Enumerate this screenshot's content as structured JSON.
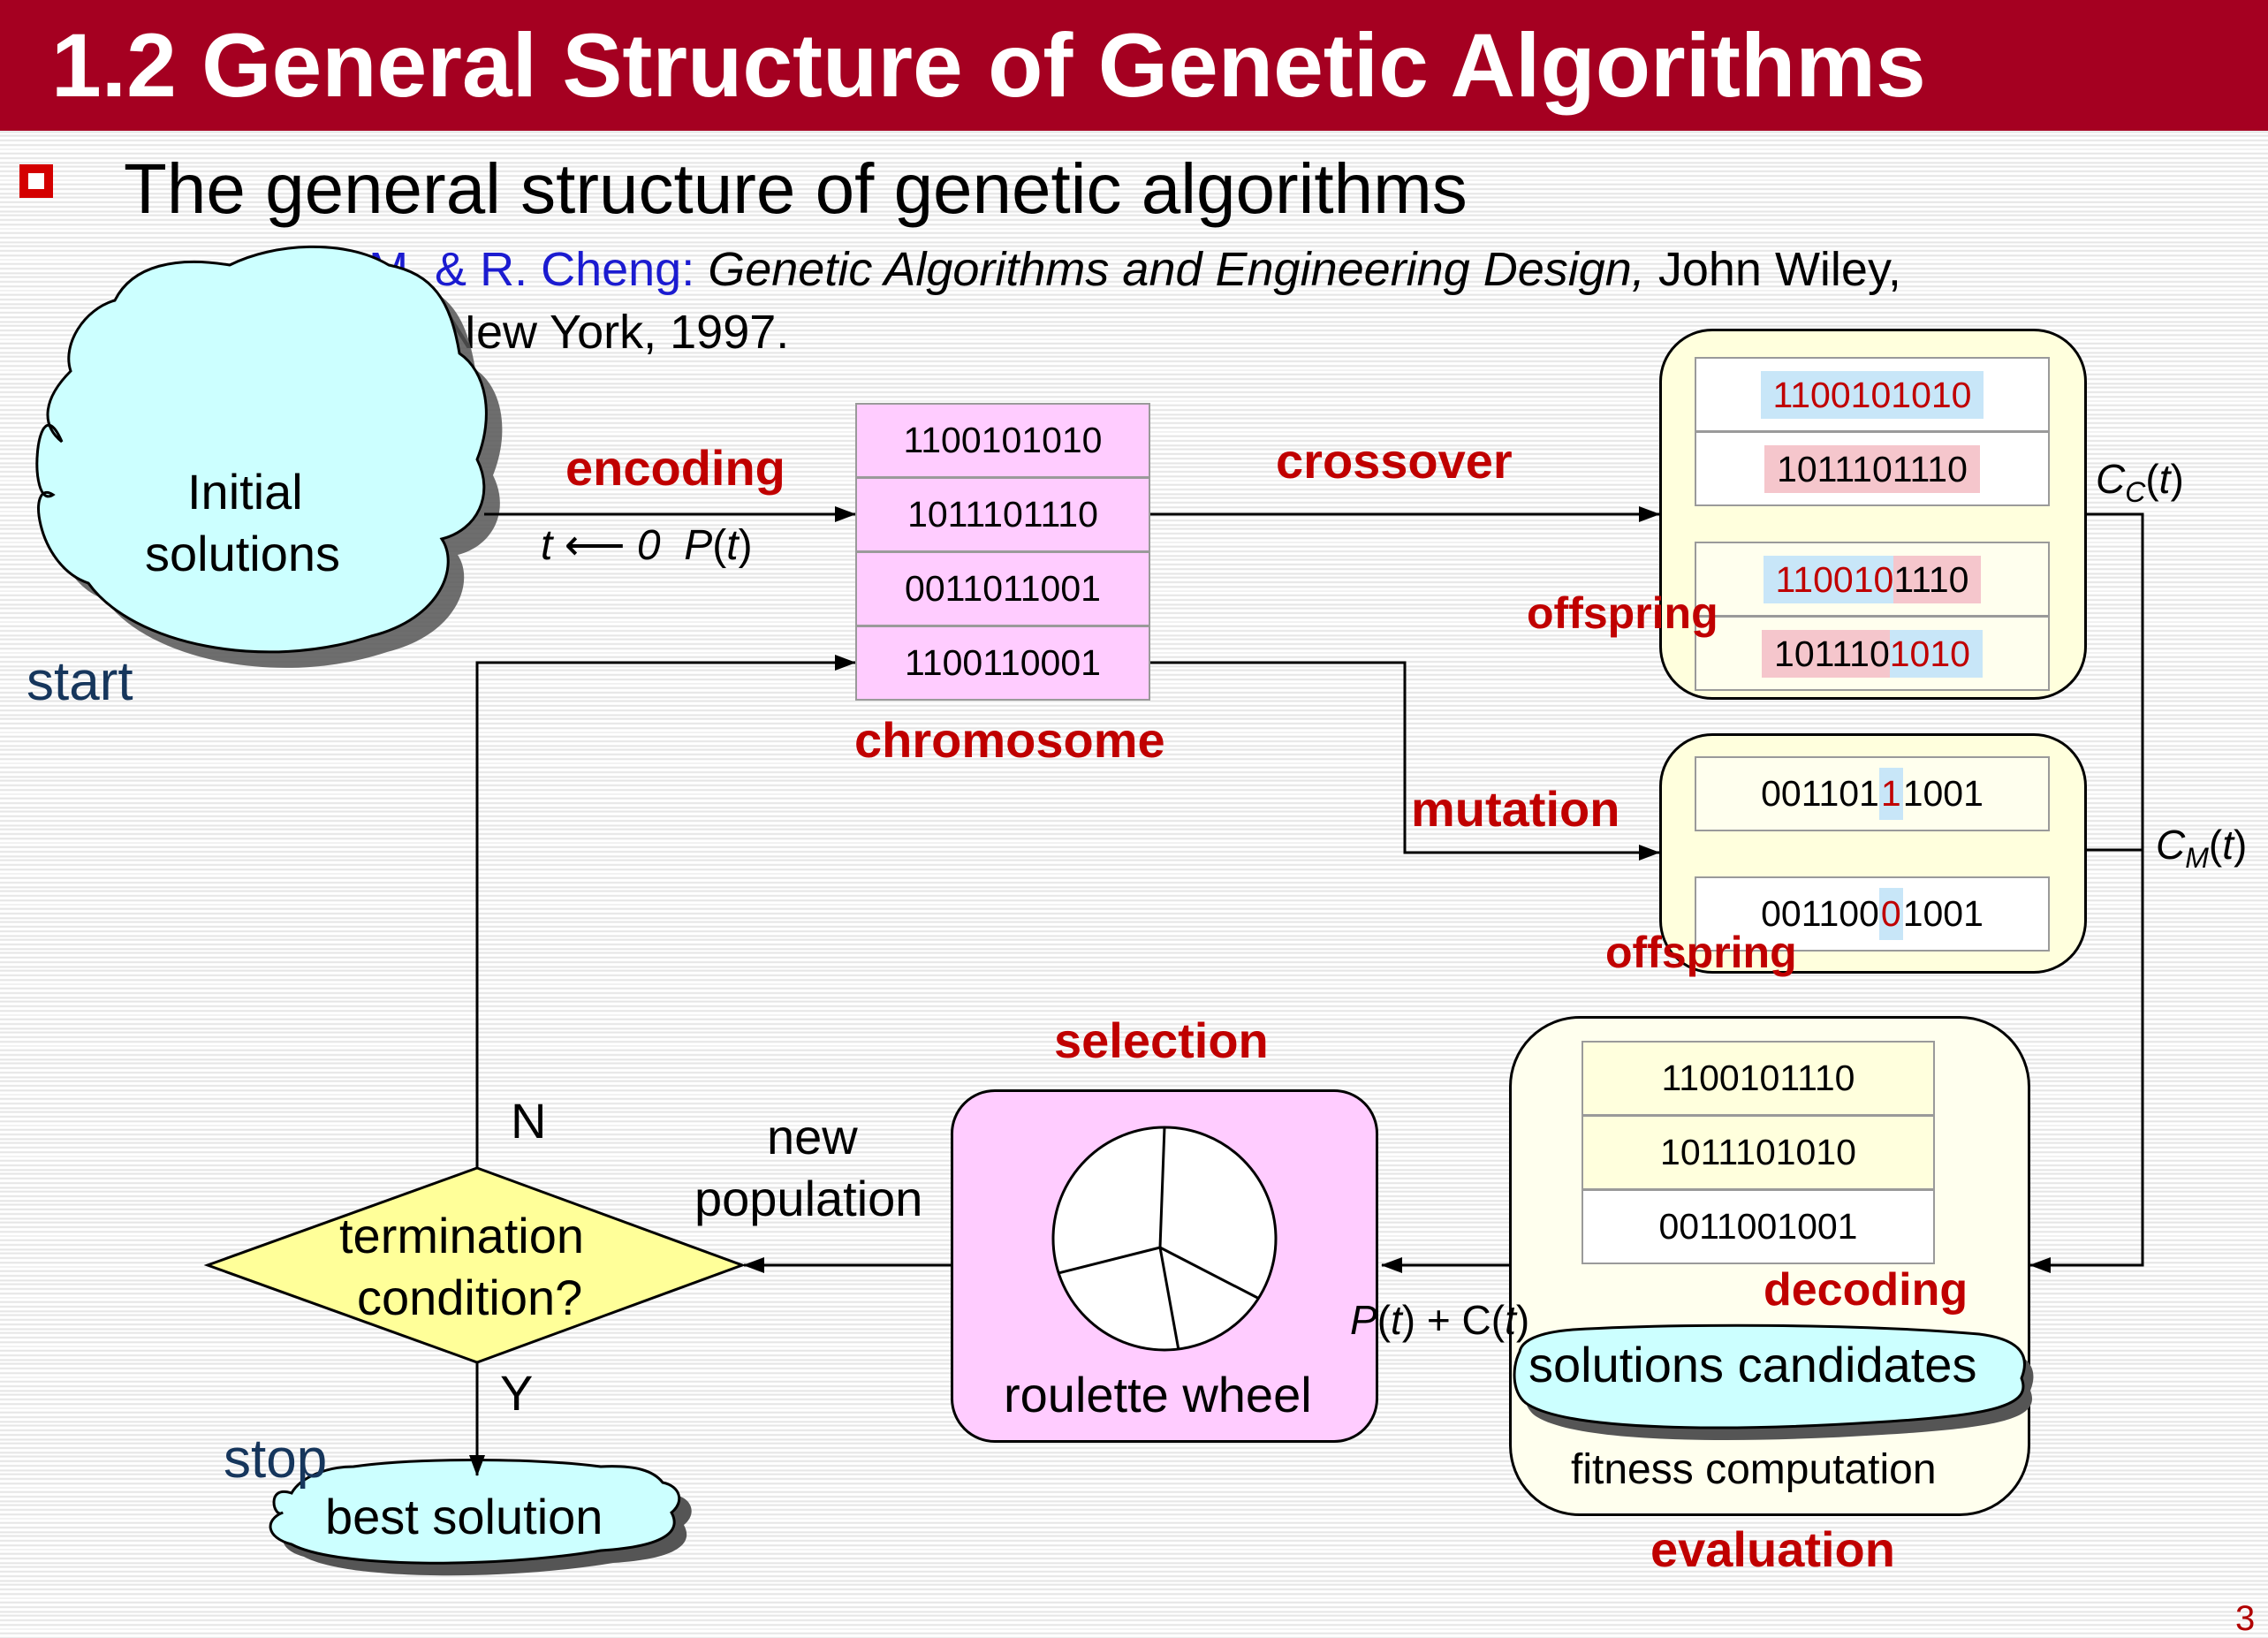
{
  "title": "1.2 General Structure of Genetic Algorithms",
  "subtitle": "The general structure of genetic algorithms",
  "reference": {
    "authors": "Gen, M. & R. Cheng:",
    "book": "Genetic Algorithms and Engineering Design,",
    "publisher": "John Wiley,",
    "place_year": "New York, 1997."
  },
  "start": {
    "label": "start",
    "cloud_text_line1": "Initial",
    "cloud_text_line2": "solutions"
  },
  "encoding": {
    "label": "encoding",
    "t_init": "t",
    "arrow_glyph": "⟵",
    "zero": "0",
    "P": "P",
    "open": "(",
    "t": "t",
    "close": ")"
  },
  "chromosome": {
    "label": "chromosome",
    "rows": [
      "1100101010",
      "1011101110",
      "0011011001",
      "1100110001"
    ]
  },
  "crossover": {
    "label": "crossover",
    "parent1": "1100101010",
    "parent2": "1011101110",
    "child1_a": "110010",
    "child1_b": "1110",
    "child2_a": "101110",
    "child2_b": "1010",
    "offspring_label": "offspring",
    "Cc_main": "C",
    "Cc_sub": "C",
    "Cc_rest_open": "(",
    "Cc_t": "t",
    "Cc_rest_close": ")"
  },
  "mutation": {
    "label": "mutation",
    "before_a": "001101",
    "before_b": "1",
    "before_c": "1001",
    "after_a": "001100",
    "after_b": "0",
    "after_c": "1001",
    "offspring_label": "offspring",
    "Cm_main": "C",
    "Cm_sub": "M",
    "Cm_open": "(",
    "Cm_t": "t",
    "Cm_close": ")"
  },
  "evaluation": {
    "label": "evaluation",
    "rows": [
      "1100101110",
      "1011101010",
      "0011001001"
    ],
    "decoding_label": "decoding",
    "candidates": "solutions candidates",
    "fitness": "fitness computation",
    "merge_P": "P",
    "merge_open": "(",
    "merge_t": "t",
    "merge_mid": ") + C(",
    "merge_t2": "t",
    "merge_close": ")"
  },
  "selection": {
    "label": "selection",
    "wheel_label": "roulette wheel",
    "slices": [
      0.34,
      0.14,
      0.22,
      0.3
    ]
  },
  "new_population": {
    "line1": "new",
    "line2": "population"
  },
  "termination": {
    "line1": "termination",
    "line2": "condition?",
    "no": "N",
    "yes": "Y"
  },
  "stop": {
    "label": "stop",
    "best": "best solution"
  },
  "page_number": "3",
  "colors": {
    "title_bar": "#a50021",
    "red_label": "#c00000",
    "cloud_fill": "#ccffff",
    "diamond_fill": "#ffff99",
    "pink_fill": "#ffccff",
    "cream_fill": "#ffffdd",
    "reference_blue": "#1b1bd0",
    "navy": "#16365c"
  }
}
